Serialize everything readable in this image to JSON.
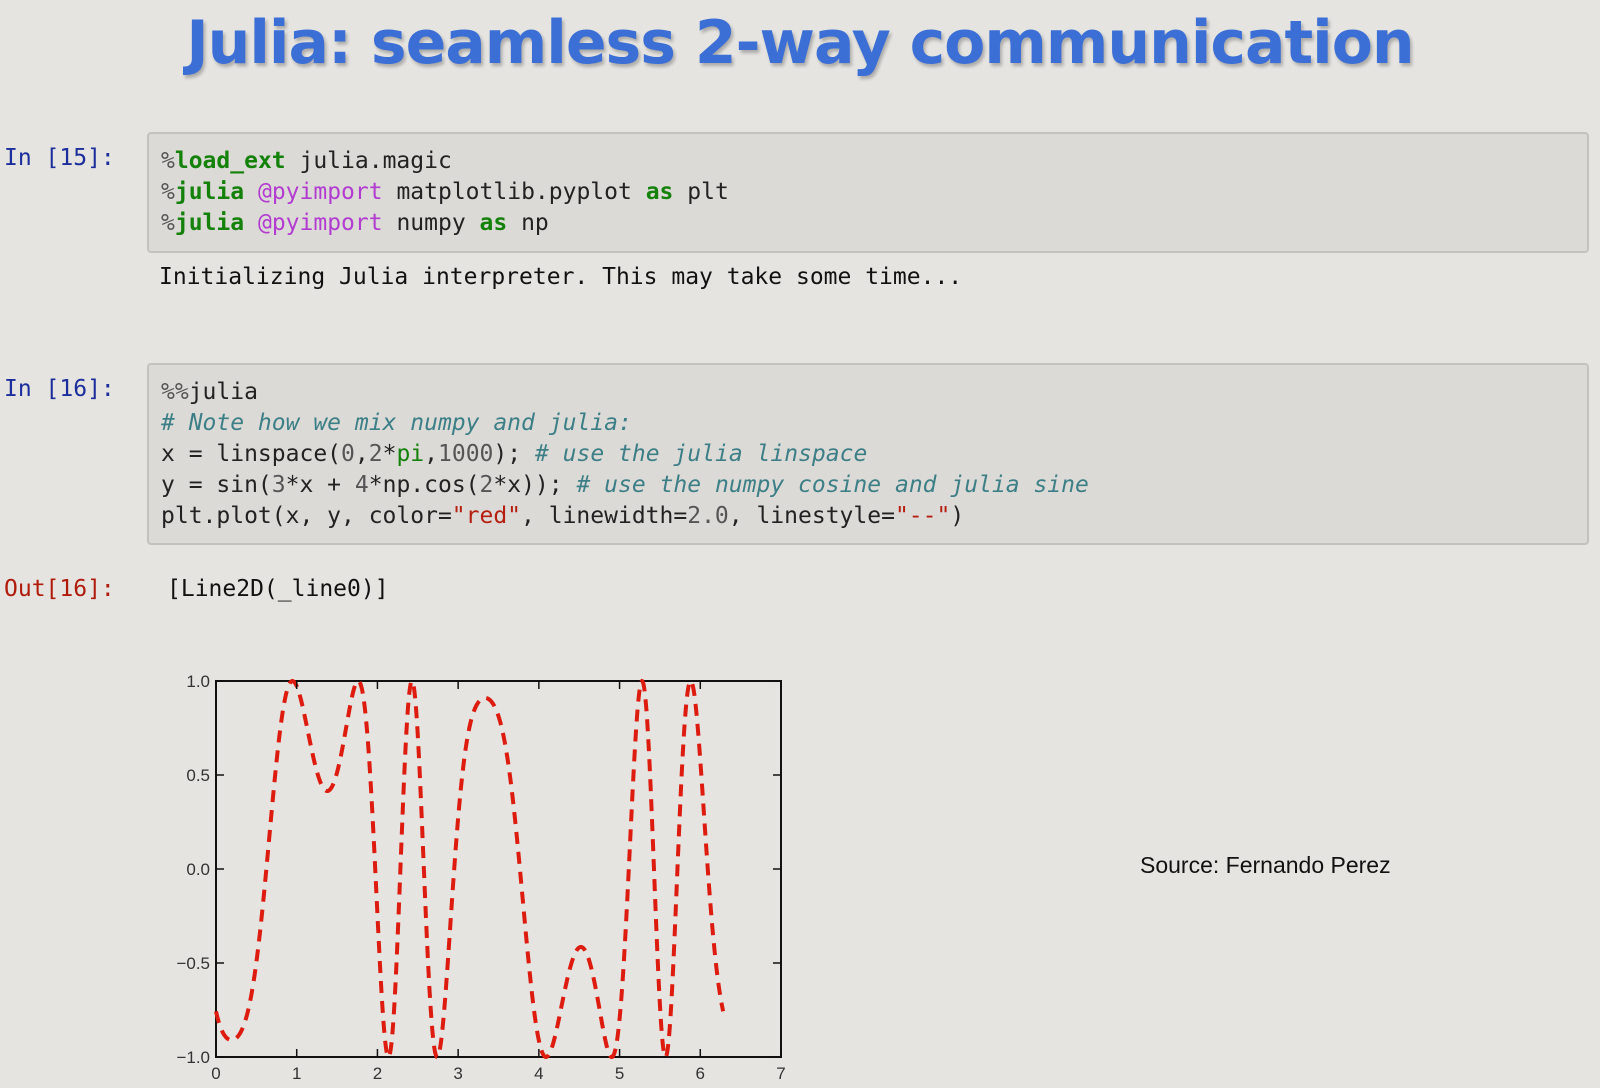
{
  "slide": {
    "title": "Julia: seamless 2-way communication",
    "source": "Source: Fernando Perez"
  },
  "cells": [
    {
      "prompt": "In [15]:",
      "lines": [
        [
          {
            "t": "%",
            "c": "mg"
          },
          {
            "t": "load_ext",
            "c": "kw"
          },
          {
            "t": " julia.magic",
            "c": ""
          }
        ],
        [
          {
            "t": "%",
            "c": "mg"
          },
          {
            "t": "julia",
            "c": "kw"
          },
          {
            "t": " ",
            "c": ""
          },
          {
            "t": "@pyimport",
            "c": "dec"
          },
          {
            "t": " matplotlib.pyplot ",
            "c": ""
          },
          {
            "t": "as",
            "c": "kw"
          },
          {
            "t": " plt",
            "c": ""
          }
        ],
        [
          {
            "t": "%",
            "c": "mg"
          },
          {
            "t": "julia",
            "c": "kw"
          },
          {
            "t": " ",
            "c": ""
          },
          {
            "t": "@pyimport",
            "c": "dec"
          },
          {
            "t": " numpy ",
            "c": ""
          },
          {
            "t": "as",
            "c": "kw"
          },
          {
            "t": " np",
            "c": ""
          }
        ]
      ],
      "stdout": "Initializing Julia interpreter. This may take some time..."
    },
    {
      "prompt": "In [16]:",
      "lines": [
        [
          {
            "t": "%%",
            "c": "mg"
          },
          {
            "t": "julia",
            "c": ""
          }
        ],
        [
          {
            "t": "# Note how we mix numpy and julia:",
            "c": "cm"
          }
        ],
        [
          {
            "t": "x = linspace(",
            "c": ""
          },
          {
            "t": "0",
            "c": "num"
          },
          {
            "t": ",",
            "c": ""
          },
          {
            "t": "2",
            "c": "num"
          },
          {
            "t": "*",
            "c": ""
          },
          {
            "t": "pi",
            "c": "bi"
          },
          {
            "t": ",",
            "c": ""
          },
          {
            "t": "1000",
            "c": "num"
          },
          {
            "t": "); ",
            "c": ""
          },
          {
            "t": "# use the julia linspace",
            "c": "cm"
          }
        ],
        [
          {
            "t": "y = sin(",
            "c": ""
          },
          {
            "t": "3",
            "c": "num"
          },
          {
            "t": "*x + ",
            "c": ""
          },
          {
            "t": "4",
            "c": "num"
          },
          {
            "t": "*np.cos(",
            "c": ""
          },
          {
            "t": "2",
            "c": "num"
          },
          {
            "t": "*x)); ",
            "c": ""
          },
          {
            "t": "# use the numpy cosine and julia sine",
            "c": "cm"
          }
        ],
        [
          {
            "t": "plt.plot(x, y, color=",
            "c": ""
          },
          {
            "t": "\"red\"",
            "c": "str"
          },
          {
            "t": ", linewidth=",
            "c": ""
          },
          {
            "t": "2.0",
            "c": "num"
          },
          {
            "t": ", linestyle=",
            "c": ""
          },
          {
            "t": "\"--\"",
            "c": "str"
          },
          {
            "t": ")",
            "c": ""
          }
        ]
      ],
      "out_prompt": "Out[16]:",
      "out_value": "[Line2D(_line0)]"
    }
  ],
  "chart_data": {
    "type": "line",
    "function": "y = sin(3*x + 4*cos(2*x))",
    "x_range": [
      0,
      6.283185307
    ],
    "n_points": 1000,
    "xlim": [
      0,
      7
    ],
    "ylim": [
      -1.0,
      1.0
    ],
    "x_ticks": [
      "0",
      "1",
      "2",
      "3",
      "4",
      "5",
      "6",
      "7"
    ],
    "y_ticks": [
      "1.0",
      "0.5",
      "0.0",
      "−0.5",
      "−1.0"
    ],
    "series": [
      {
        "color": "#dd1c0f",
        "linewidth": 2.0,
        "linestyle": "--"
      }
    ],
    "grid": false,
    "title": "",
    "xlabel": "",
    "ylabel": ""
  }
}
